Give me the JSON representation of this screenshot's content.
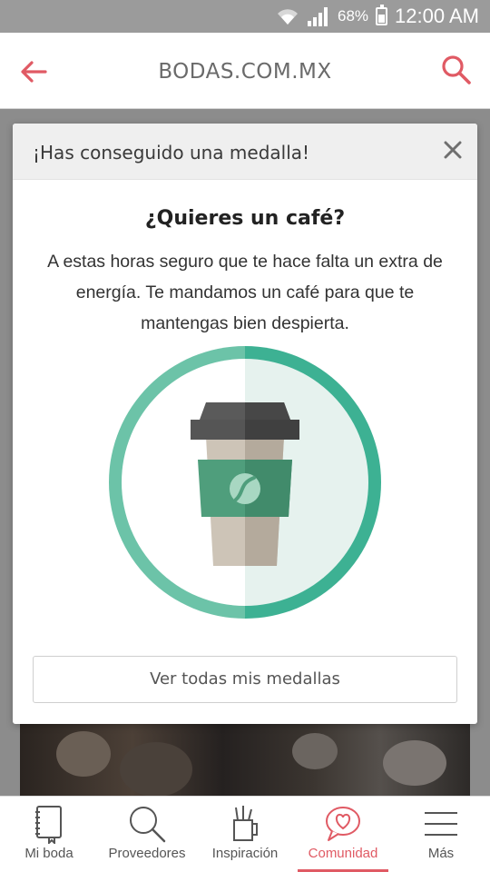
{
  "status_bar": {
    "battery": "68%",
    "time": "12:00 AM"
  },
  "header": {
    "title": "BODAS.COM.MX"
  },
  "modal": {
    "header_title": "¡Has conseguido una medalla!",
    "title": "¿Quieres un café?",
    "text": "A estas horas seguro que te hace falta un extra de energía. Te mandamos un café para que te mantengas bien despierta.",
    "button_label": "Ver todas mis medallas"
  },
  "bottom_nav": {
    "items": [
      {
        "label": "Mi boda",
        "icon": "notebook-icon"
      },
      {
        "label": "Proveedores",
        "icon": "search-icon"
      },
      {
        "label": "Inspiración",
        "icon": "pencil-cup-icon"
      },
      {
        "label": "Comunidad",
        "icon": "heart-chat-icon",
        "active": true
      },
      {
        "label": "Más",
        "icon": "menu-icon"
      }
    ]
  },
  "colors": {
    "accent": "#e05a64",
    "badge_green": "#3db193",
    "badge_light_green": "#6cc3a8"
  }
}
